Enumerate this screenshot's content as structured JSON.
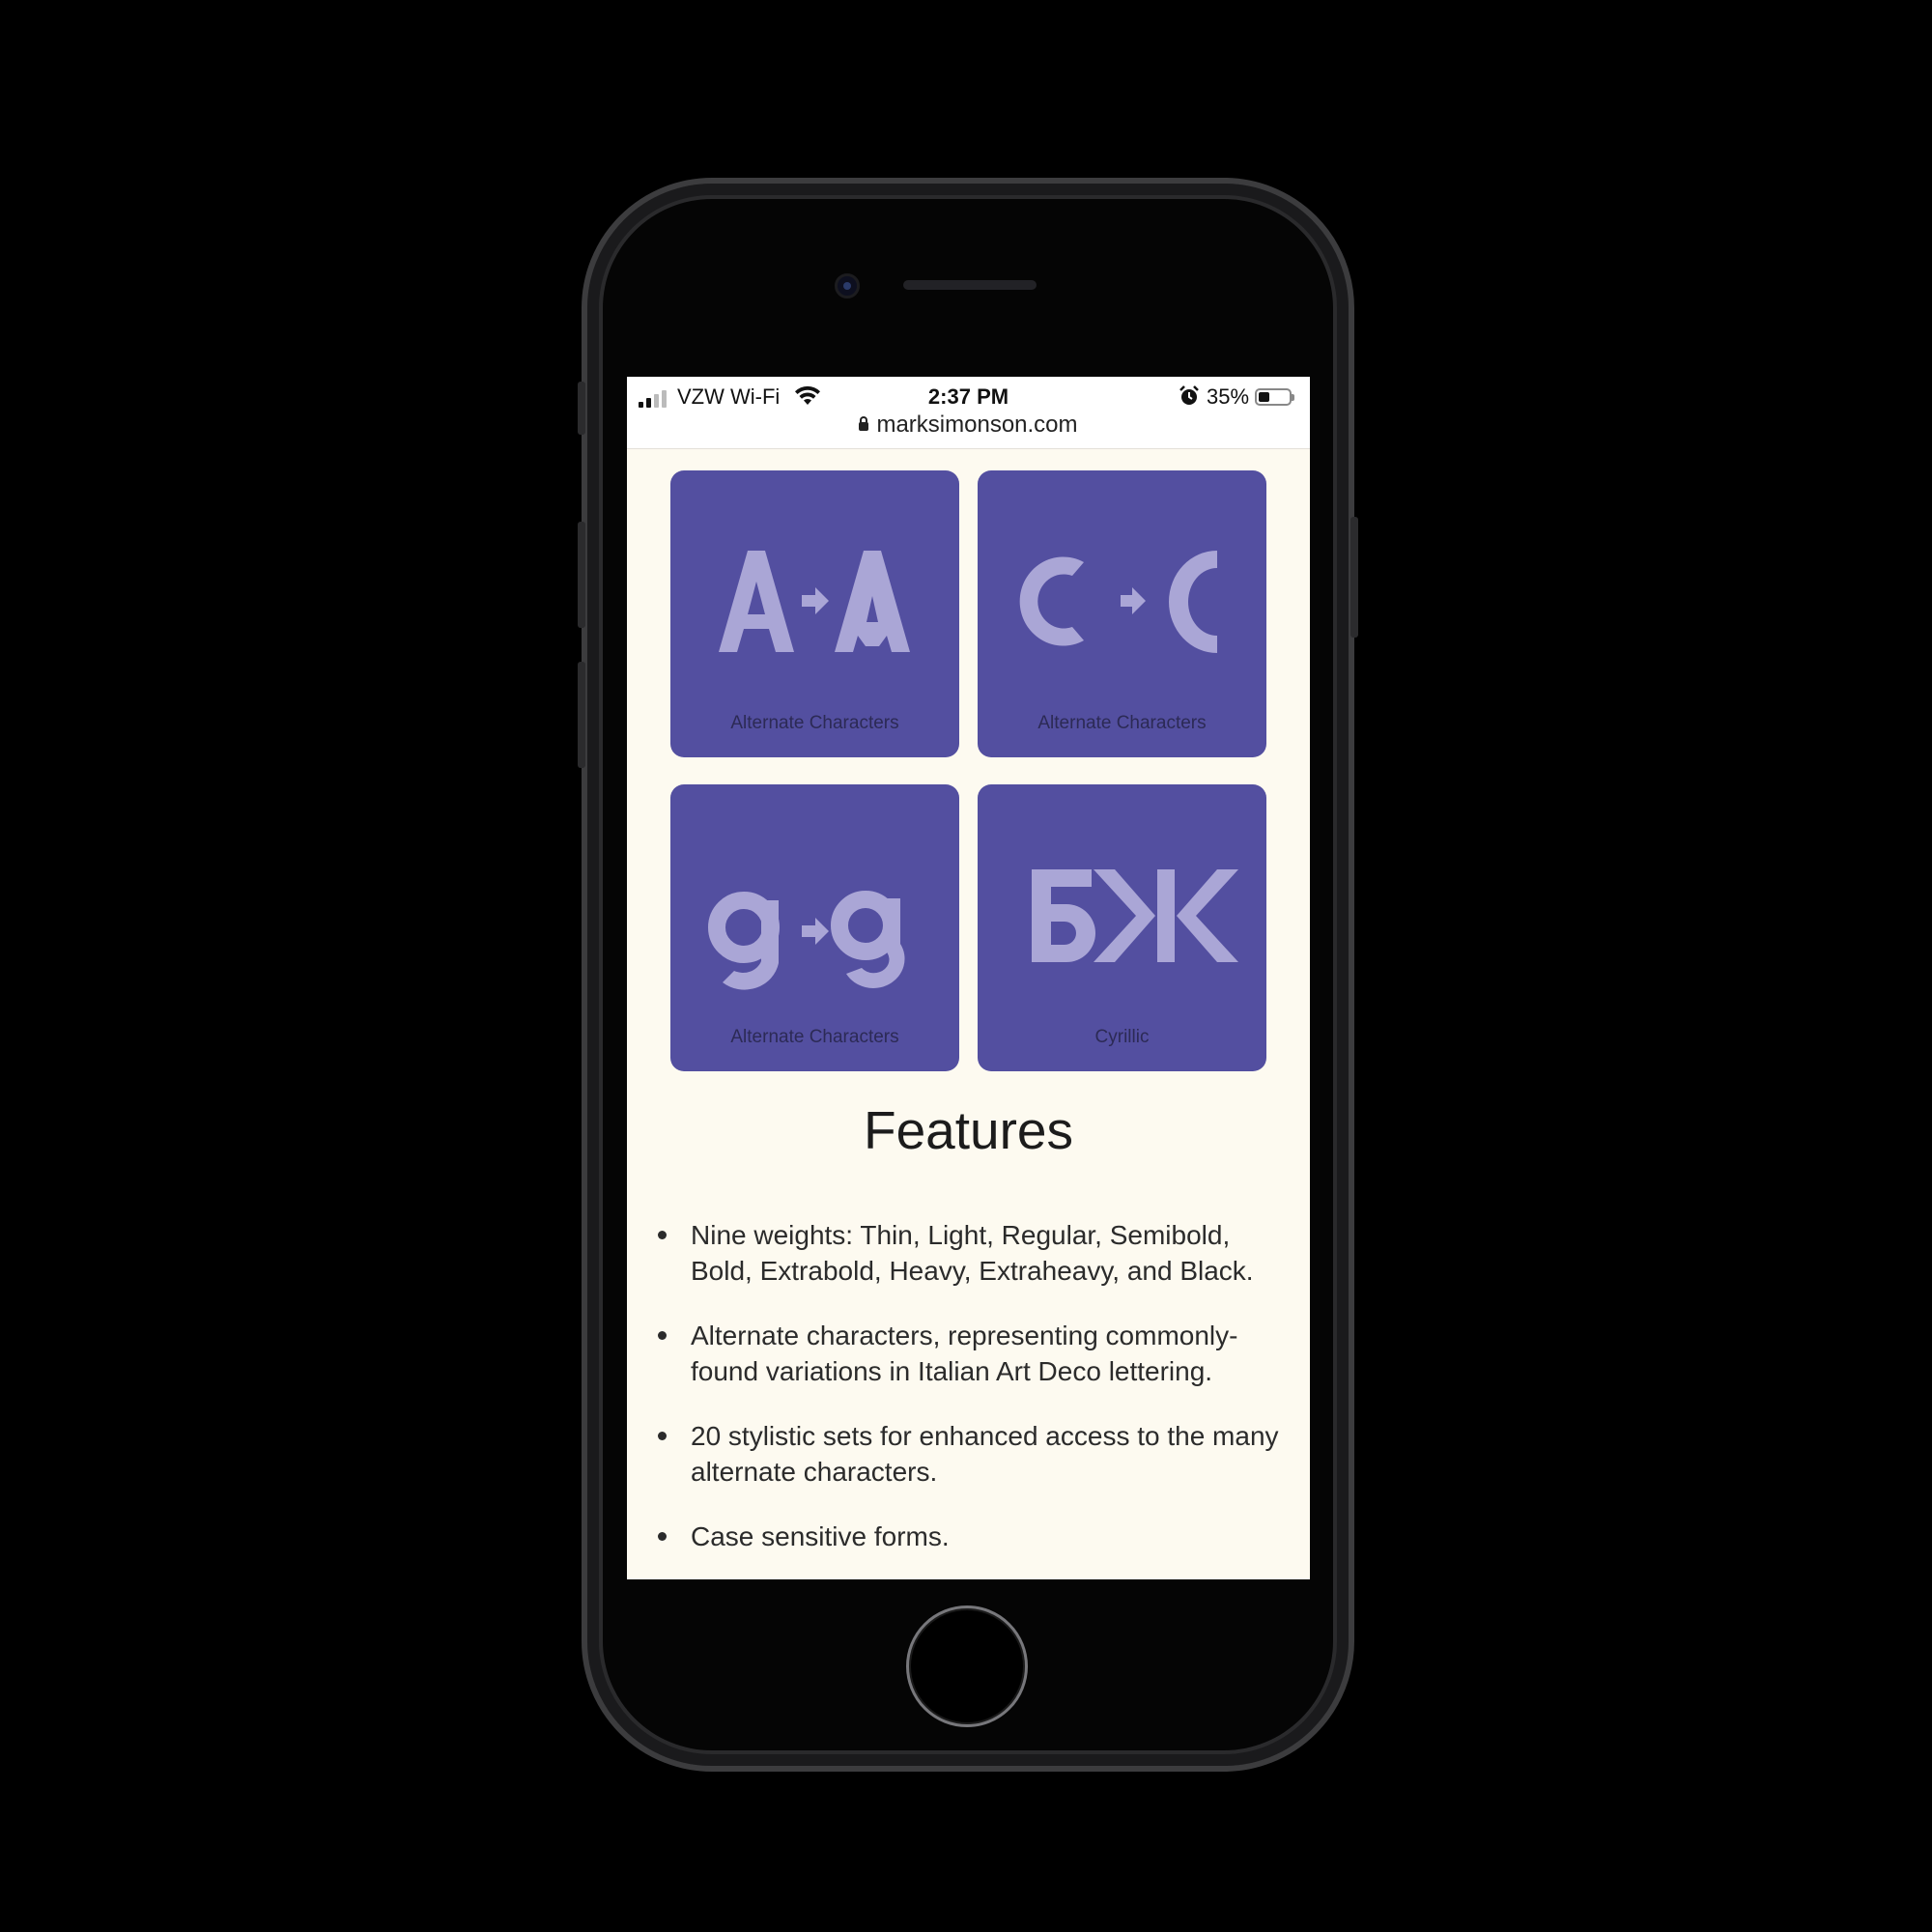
{
  "status_bar": {
    "carrier": "VZW Wi-Fi",
    "time": "2:37 PM",
    "battery_percent": "35%",
    "battery_level": 0.35,
    "url": "marksimonson.com"
  },
  "tiles": [
    {
      "glyph_from": "A",
      "glyph_to": "A",
      "caption": "Alternate Characters"
    },
    {
      "glyph_from": "C",
      "glyph_to": "C",
      "caption": "Alternate Characters"
    },
    {
      "glyph_from": "g",
      "glyph_to": "g",
      "caption": "Alternate Characters"
    },
    {
      "glyph_from": "БЖ",
      "caption": "Cyrillic"
    }
  ],
  "features": {
    "heading": "Features",
    "items": [
      "Nine weights: Thin, Light, Regular, Semibold, Bold, Extrabold, Heavy, Extraheavy, and Black.",
      "Alternate characters, representing commonly-found variations in Italian Art Deco lettering.",
      "20 stylistic sets for enhanced access to the many alternate characters.",
      "Case sensitive forms."
    ]
  },
  "colors": {
    "tile": "#534fa0",
    "glyph": "#aaa6d6",
    "page_bg": "#fdfaf0"
  }
}
